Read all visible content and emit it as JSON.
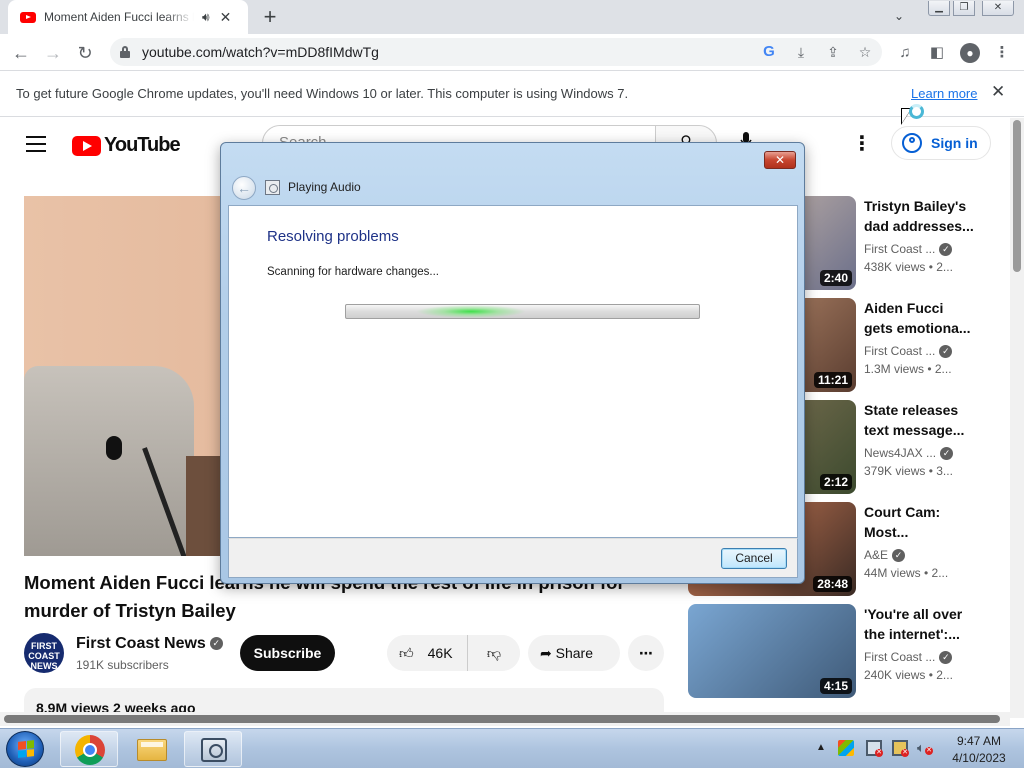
{
  "browser": {
    "tab_title": "Moment Aiden Fucci learns he will spend the rest of life in prison for murder of Tristyn Bailey",
    "tab_audio_icon": "speaker-icon",
    "tab_close": "✕",
    "new_tab": "+",
    "url": "youtube.com/watch?v=mDD8fIMdwTg"
  },
  "infobar": {
    "message": "To get future Google Chrome updates, you'll need Windows 10 or later. This computer is using Windows 7.",
    "link": "Learn more",
    "close": "✕"
  },
  "youtube": {
    "logo_text": "YouTube",
    "search_placeholder": "Search",
    "sign_in": "Sign in",
    "video_title": "Moment Aiden Fucci learns he will spend the rest of life in prison for murder of Tristyn Bailey",
    "channel": {
      "name": "First Coast News",
      "subscribers": "191K subscribers",
      "avatar_text": "FIRST COAST NEWS"
    },
    "subscribe": "Subscribe",
    "likes": "46K",
    "share": "Share",
    "more": "⋯",
    "views_line": "8.9M views  2 weeks ago",
    "recommendations": [
      {
        "title1": "Tristyn Bailey's",
        "title2": "dad addresses...",
        "channel": "First Coast ...",
        "meta": "438K views  • 2...",
        "duration": "2:40",
        "thumb": [
          "#d9c3b0",
          "#6b6f8a"
        ]
      },
      {
        "title1": "Aiden Fucci",
        "title2": "gets emotiona...",
        "channel": "First Coast ...",
        "meta": "1.3M views  • 2...",
        "duration": "11:21",
        "thumb": [
          "#c69676",
          "#5a3d30"
        ]
      },
      {
        "title1": "State releases",
        "title2": "text message...",
        "channel": "News4JAX ...",
        "meta": "379K views  • 3...",
        "duration": "2:12",
        "thumb": [
          "#8c7a5c",
          "#3c4a2e"
        ]
      },
      {
        "title1": "Court Cam:",
        "title2": "Most...",
        "channel": "A&E",
        "meta": "44M views  • 2...",
        "duration": "28:48",
        "thumb": [
          "#d9825a",
          "#3a2a24"
        ]
      },
      {
        "title1": "'You're all over",
        "title2": "the internet':...",
        "channel": "First Coast ...",
        "meta": "240K views  • 2...",
        "duration": "4:15",
        "thumb": [
          "#7aa6d2",
          "#3f5a78"
        ]
      }
    ]
  },
  "dialog": {
    "caption": "Playing Audio",
    "heading": "Resolving problems",
    "status": "Scanning for hardware changes...",
    "cancel": "Cancel",
    "close": "✕",
    "progress_state": "indeterminate"
  },
  "taskbar": {
    "time": "9:47 AM",
    "date": "4/10/2023",
    "tray_arrow": "▲"
  },
  "colors": {
    "youtube_red": "#ff0000",
    "link_blue": "#065fd4",
    "dialog_heading": "#1e3287"
  }
}
